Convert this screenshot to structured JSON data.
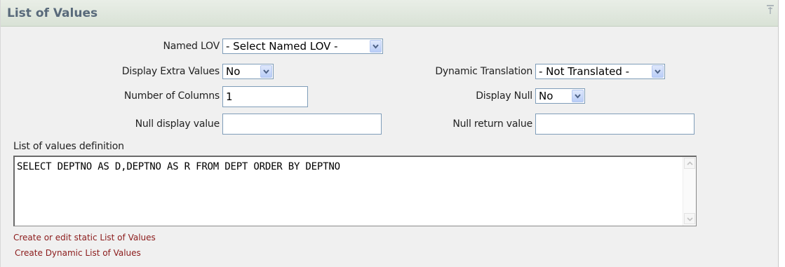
{
  "region": {
    "title": "List of Values"
  },
  "fields": {
    "named_lov": {
      "label": "Named LOV",
      "value": "- Select Named LOV -"
    },
    "display_extra_values": {
      "label": "Display Extra Values",
      "value": "No"
    },
    "dynamic_translation": {
      "label": "Dynamic Translation",
      "value": "- Not Translated -"
    },
    "number_of_columns": {
      "label": "Number of Columns",
      "value": "1"
    },
    "display_null": {
      "label": "Display Null",
      "value": "No"
    },
    "null_display_value": {
      "label": "Null display value",
      "value": ""
    },
    "null_return_value": {
      "label": "Null return value",
      "value": ""
    },
    "lov_definition": {
      "label": "List of values definition",
      "value": "SELECT DEPTNO AS D,DEPTNO AS R FROM DEPT ORDER BY DEPTNO"
    }
  },
  "links": {
    "static_lov": "Create or edit static List of Values",
    "dynamic_lov": "Create Dynamic List of Values"
  },
  "colors": {
    "title": "#58697a",
    "link": "#8b1a1a",
    "header_bg": "#dde5da",
    "body_bg": "#f0f0f0"
  },
  "icons": {
    "dropdown": "chevron-down-icon",
    "pin": "pin-icon",
    "scroll_up": "scroll-up-arrow-icon",
    "scroll_down": "scroll-down-arrow-icon"
  }
}
